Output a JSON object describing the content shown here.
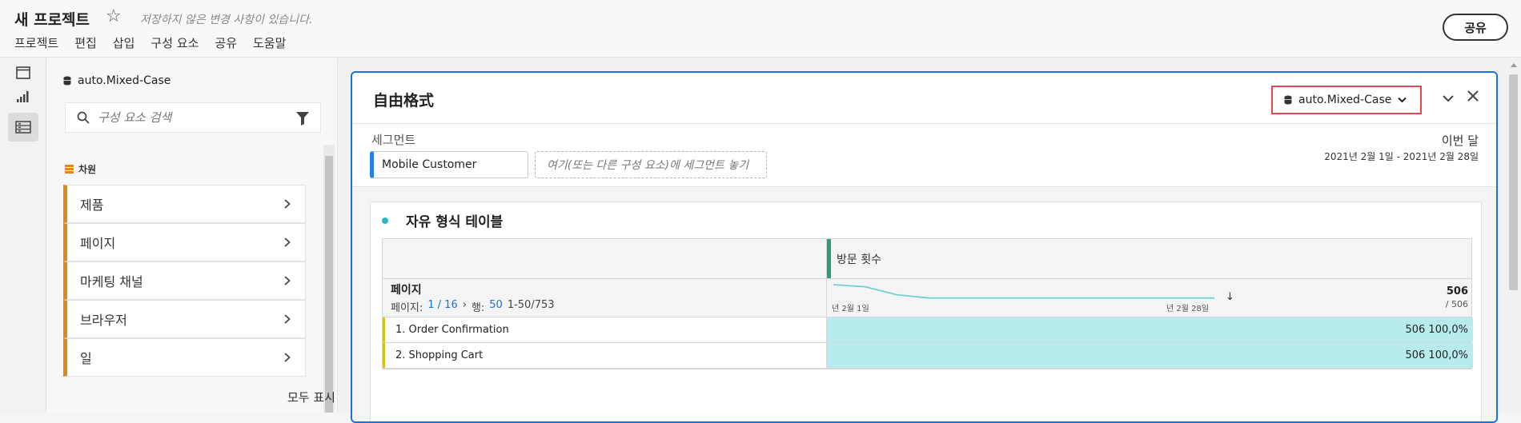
{
  "header": {
    "project_title": "새 프로젝트",
    "unsaved_notice": "저장하지 않은 변경 사항이 있습니다.",
    "share_label": "공유",
    "menu": [
      "프로젝트",
      "편집",
      "삽입",
      "구성 요소",
      "공유",
      "도움말"
    ]
  },
  "rail": {
    "icons": [
      "panels-icon",
      "visualizations-icon",
      "components-icon"
    ]
  },
  "panel": {
    "report_suite": "auto.Mixed-Case",
    "search_placeholder": "구성 요소 검색",
    "dimensions_header": "차원",
    "dimensions": [
      "제품",
      "페이지",
      "마케팅 채널",
      "브라우저",
      "일"
    ],
    "show_all": "모두 표시"
  },
  "card": {
    "title": "自由格式",
    "report_suite": "auto.Mixed-Case",
    "segments_label": "세그먼트",
    "segment_chip": "Mobile Customer",
    "segment_drop_placeholder": "여기(또는 다른 구성 요소)에 세그먼트 놓기",
    "date_label": "이번 달",
    "date_range": "2021년 2월 1일 - 2021년 2월 28일"
  },
  "table": {
    "title": "자유 형식 테이블",
    "metric_name": "방문 횟수",
    "dimension_name": "페이지",
    "pager": {
      "page_label": "페이지:",
      "page_value": "1 / 16",
      "rows_label": "행:",
      "rows_value": "50",
      "range": "1-50/753"
    },
    "sparkline_start": "년 2월 1일",
    "sparkline_end": "년 2월 28일",
    "sparkline_values": [
      506,
      490,
      430,
      405,
      405,
      405,
      405,
      405,
      405,
      405,
      405,
      405,
      405
    ],
    "total": "506",
    "total_of": "/ 506",
    "rows": [
      {
        "label": "1. Order Confirmation",
        "value": "506 100,0%"
      },
      {
        "label": "2. Shopping Cart",
        "value": "506 100,0%"
      }
    ]
  },
  "colors": {
    "accent_blue": "#1473e6",
    "highlight_red": "#e34850",
    "dimension_orange": "#e68619",
    "metric_green": "#2d9d78",
    "cell_teal": "#b8ebed"
  }
}
